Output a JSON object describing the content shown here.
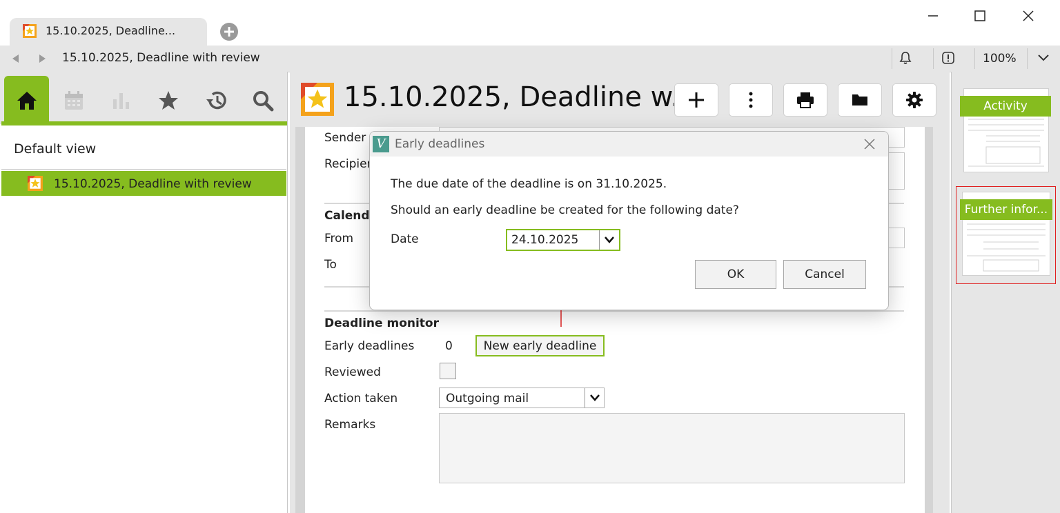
{
  "window": {
    "tab_title": "15.10.2025, Deadline...",
    "address_title": "15.10.2025, Deadline with review",
    "zoom": "100%"
  },
  "left_panel": {
    "view_title": "Default view",
    "tree_items": [
      {
        "label": "15.10.2025, Deadline with review"
      }
    ]
  },
  "document": {
    "title": "15.10.2025, Deadline w...",
    "toolbar": [
      "add-icon",
      "more-icon",
      "print-icon",
      "folder-icon",
      "settings-icon"
    ]
  },
  "form": {
    "sender_label": "Sender",
    "recipient_label": "Recipien",
    "calendar_heading": "Calenda",
    "from_label": "From",
    "to_label": "To",
    "deadline_heading": "Deadline monitor",
    "early_label": "Early deadlines",
    "early_count": "0",
    "new_early_button": "New early deadline",
    "reviewed_label": "Reviewed",
    "action_label": "Action taken",
    "action_value": "Outgoing mail",
    "remarks_label": "Remarks"
  },
  "right_panel": {
    "thumbs": [
      {
        "label": "Activity"
      },
      {
        "label": "Further infor..."
      }
    ]
  },
  "dialog": {
    "logo": "V",
    "title": "Early deadlines",
    "message1": "The due date of the deadline is on 31.10.2025.",
    "message2": "Should an early deadline be created for the following date?",
    "date_label": "Date",
    "date_value": "24.10.2025",
    "ok_label": "OK",
    "cancel_label": "Cancel"
  },
  "colors": {
    "accent": "#86bc1f",
    "highlight": "#e02020",
    "chrome": "#e6e6e6"
  }
}
